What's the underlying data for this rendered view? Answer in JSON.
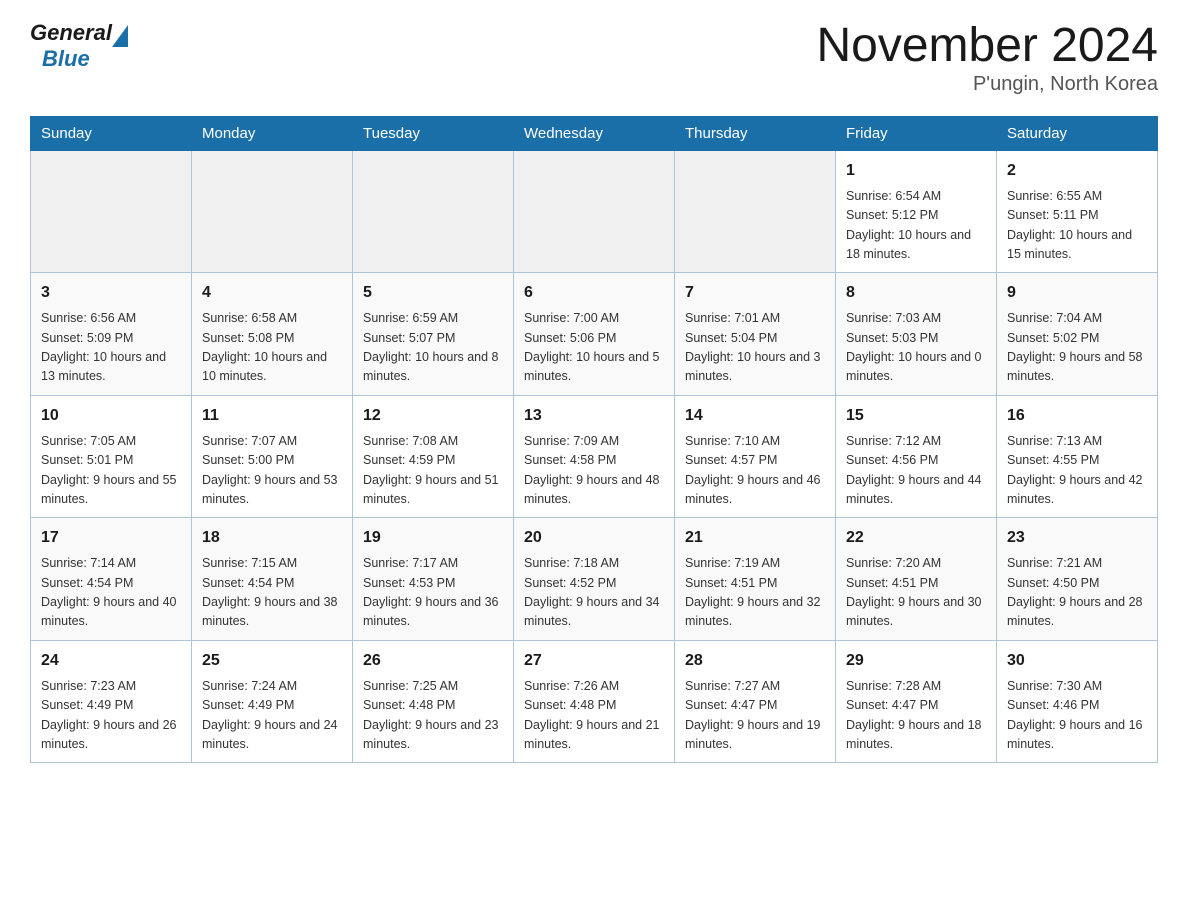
{
  "header": {
    "logo_general": "General",
    "logo_blue": "Blue",
    "title": "November 2024",
    "subtitle": "P'ungin, North Korea"
  },
  "weekdays": [
    "Sunday",
    "Monday",
    "Tuesday",
    "Wednesday",
    "Thursday",
    "Friday",
    "Saturday"
  ],
  "weeks": [
    [
      {
        "day": "",
        "sunrise": "",
        "sunset": "",
        "daylight": ""
      },
      {
        "day": "",
        "sunrise": "",
        "sunset": "",
        "daylight": ""
      },
      {
        "day": "",
        "sunrise": "",
        "sunset": "",
        "daylight": ""
      },
      {
        "day": "",
        "sunrise": "",
        "sunset": "",
        "daylight": ""
      },
      {
        "day": "",
        "sunrise": "",
        "sunset": "",
        "daylight": ""
      },
      {
        "day": "1",
        "sunrise": "Sunrise: 6:54 AM",
        "sunset": "Sunset: 5:12 PM",
        "daylight": "Daylight: 10 hours and 18 minutes."
      },
      {
        "day": "2",
        "sunrise": "Sunrise: 6:55 AM",
        "sunset": "Sunset: 5:11 PM",
        "daylight": "Daylight: 10 hours and 15 minutes."
      }
    ],
    [
      {
        "day": "3",
        "sunrise": "Sunrise: 6:56 AM",
        "sunset": "Sunset: 5:09 PM",
        "daylight": "Daylight: 10 hours and 13 minutes."
      },
      {
        "day": "4",
        "sunrise": "Sunrise: 6:58 AM",
        "sunset": "Sunset: 5:08 PM",
        "daylight": "Daylight: 10 hours and 10 minutes."
      },
      {
        "day": "5",
        "sunrise": "Sunrise: 6:59 AM",
        "sunset": "Sunset: 5:07 PM",
        "daylight": "Daylight: 10 hours and 8 minutes."
      },
      {
        "day": "6",
        "sunrise": "Sunrise: 7:00 AM",
        "sunset": "Sunset: 5:06 PM",
        "daylight": "Daylight: 10 hours and 5 minutes."
      },
      {
        "day": "7",
        "sunrise": "Sunrise: 7:01 AM",
        "sunset": "Sunset: 5:04 PM",
        "daylight": "Daylight: 10 hours and 3 minutes."
      },
      {
        "day": "8",
        "sunrise": "Sunrise: 7:03 AM",
        "sunset": "Sunset: 5:03 PM",
        "daylight": "Daylight: 10 hours and 0 minutes."
      },
      {
        "day": "9",
        "sunrise": "Sunrise: 7:04 AM",
        "sunset": "Sunset: 5:02 PM",
        "daylight": "Daylight: 9 hours and 58 minutes."
      }
    ],
    [
      {
        "day": "10",
        "sunrise": "Sunrise: 7:05 AM",
        "sunset": "Sunset: 5:01 PM",
        "daylight": "Daylight: 9 hours and 55 minutes."
      },
      {
        "day": "11",
        "sunrise": "Sunrise: 7:07 AM",
        "sunset": "Sunset: 5:00 PM",
        "daylight": "Daylight: 9 hours and 53 minutes."
      },
      {
        "day": "12",
        "sunrise": "Sunrise: 7:08 AM",
        "sunset": "Sunset: 4:59 PM",
        "daylight": "Daylight: 9 hours and 51 minutes."
      },
      {
        "day": "13",
        "sunrise": "Sunrise: 7:09 AM",
        "sunset": "Sunset: 4:58 PM",
        "daylight": "Daylight: 9 hours and 48 minutes."
      },
      {
        "day": "14",
        "sunrise": "Sunrise: 7:10 AM",
        "sunset": "Sunset: 4:57 PM",
        "daylight": "Daylight: 9 hours and 46 minutes."
      },
      {
        "day": "15",
        "sunrise": "Sunrise: 7:12 AM",
        "sunset": "Sunset: 4:56 PM",
        "daylight": "Daylight: 9 hours and 44 minutes."
      },
      {
        "day": "16",
        "sunrise": "Sunrise: 7:13 AM",
        "sunset": "Sunset: 4:55 PM",
        "daylight": "Daylight: 9 hours and 42 minutes."
      }
    ],
    [
      {
        "day": "17",
        "sunrise": "Sunrise: 7:14 AM",
        "sunset": "Sunset: 4:54 PM",
        "daylight": "Daylight: 9 hours and 40 minutes."
      },
      {
        "day": "18",
        "sunrise": "Sunrise: 7:15 AM",
        "sunset": "Sunset: 4:54 PM",
        "daylight": "Daylight: 9 hours and 38 minutes."
      },
      {
        "day": "19",
        "sunrise": "Sunrise: 7:17 AM",
        "sunset": "Sunset: 4:53 PM",
        "daylight": "Daylight: 9 hours and 36 minutes."
      },
      {
        "day": "20",
        "sunrise": "Sunrise: 7:18 AM",
        "sunset": "Sunset: 4:52 PM",
        "daylight": "Daylight: 9 hours and 34 minutes."
      },
      {
        "day": "21",
        "sunrise": "Sunrise: 7:19 AM",
        "sunset": "Sunset: 4:51 PM",
        "daylight": "Daylight: 9 hours and 32 minutes."
      },
      {
        "day": "22",
        "sunrise": "Sunrise: 7:20 AM",
        "sunset": "Sunset: 4:51 PM",
        "daylight": "Daylight: 9 hours and 30 minutes."
      },
      {
        "day": "23",
        "sunrise": "Sunrise: 7:21 AM",
        "sunset": "Sunset: 4:50 PM",
        "daylight": "Daylight: 9 hours and 28 minutes."
      }
    ],
    [
      {
        "day": "24",
        "sunrise": "Sunrise: 7:23 AM",
        "sunset": "Sunset: 4:49 PM",
        "daylight": "Daylight: 9 hours and 26 minutes."
      },
      {
        "day": "25",
        "sunrise": "Sunrise: 7:24 AM",
        "sunset": "Sunset: 4:49 PM",
        "daylight": "Daylight: 9 hours and 24 minutes."
      },
      {
        "day": "26",
        "sunrise": "Sunrise: 7:25 AM",
        "sunset": "Sunset: 4:48 PM",
        "daylight": "Daylight: 9 hours and 23 minutes."
      },
      {
        "day": "27",
        "sunrise": "Sunrise: 7:26 AM",
        "sunset": "Sunset: 4:48 PM",
        "daylight": "Daylight: 9 hours and 21 minutes."
      },
      {
        "day": "28",
        "sunrise": "Sunrise: 7:27 AM",
        "sunset": "Sunset: 4:47 PM",
        "daylight": "Daylight: 9 hours and 19 minutes."
      },
      {
        "day": "29",
        "sunrise": "Sunrise: 7:28 AM",
        "sunset": "Sunset: 4:47 PM",
        "daylight": "Daylight: 9 hours and 18 minutes."
      },
      {
        "day": "30",
        "sunrise": "Sunrise: 7:30 AM",
        "sunset": "Sunset: 4:46 PM",
        "daylight": "Daylight: 9 hours and 16 minutes."
      }
    ]
  ]
}
